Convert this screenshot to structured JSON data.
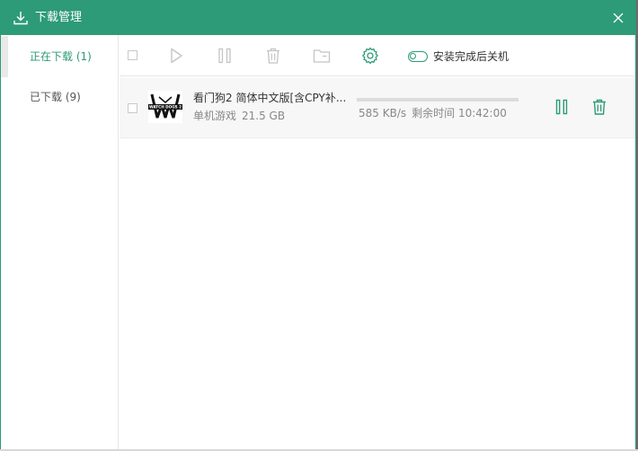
{
  "window": {
    "title": "下载管理",
    "accent_color": "#2d9a78"
  },
  "sidebar": {
    "items": [
      {
        "label": "正在下载 (1)",
        "active": true
      },
      {
        "label": "已下载 (9)",
        "active": false
      }
    ]
  },
  "toolbar": {
    "buttons": [
      "select-all-checkbox",
      "play-icon",
      "pause-icon",
      "trash-icon",
      "folder-icon",
      "gear-icon"
    ],
    "shutdown_toggle_label": "安装完成后关机",
    "shutdown_toggle_on": false
  },
  "downloads": [
    {
      "name": "看门狗2  简体中文版[含CPY补...",
      "category": "单机游戏",
      "size": "21.5 GB",
      "speed": "585 KB/s",
      "remaining": "剩余时间 10:42:00",
      "progress": 0.0,
      "icon_text": "WATCH DOGS 2"
    }
  ]
}
